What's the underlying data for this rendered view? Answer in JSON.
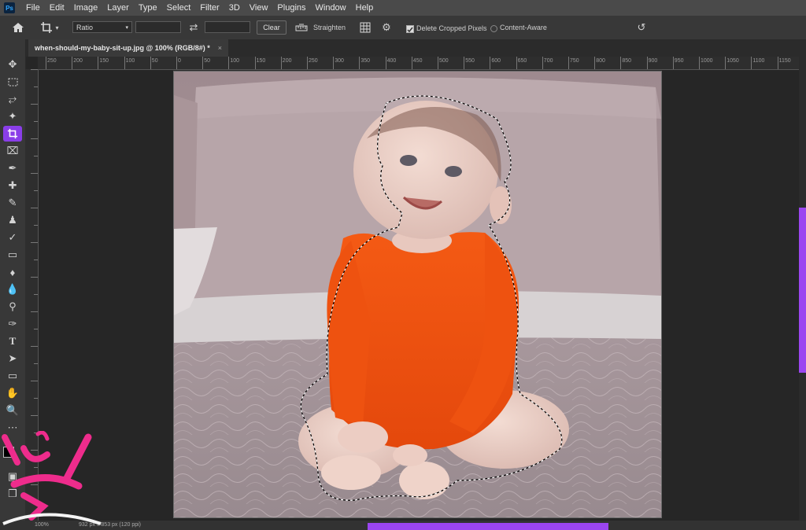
{
  "app": {
    "logo_text": "Ps"
  },
  "menu": [
    "File",
    "Edit",
    "Image",
    "Layer",
    "Type",
    "Select",
    "Filter",
    "3D",
    "View",
    "Plugins",
    "Window",
    "Help"
  ],
  "options": {
    "ratio_label": "Ratio",
    "clear_label": "Clear",
    "straighten_label": "Straighten",
    "delete_cropped_label": "Delete Cropped Pixels",
    "delete_cropped_checked": true,
    "content_aware_label": "Content-Aware",
    "content_aware_checked": false
  },
  "document": {
    "tab_title": "when-should-my-baby-sit-up.jpg @ 100% (RGB/8#) *",
    "close_glyph": "×"
  },
  "rulers": {
    "top_labels": [
      "250",
      "200",
      "150",
      "100",
      "50",
      "0",
      "50",
      "100",
      "150",
      "200",
      "250",
      "300",
      "350",
      "400",
      "450",
      "500",
      "550",
      "600",
      "650",
      "700",
      "750",
      "800",
      "850",
      "900",
      "950",
      "1000",
      "1050",
      "1100",
      "1150"
    ]
  },
  "status": {
    "zoom": "100%",
    "doc_size": "932 px x 853 px (120 ppi)"
  },
  "colors": {
    "accent": "#9b45f0",
    "onesie": "#f25410",
    "pillow": "#b7a5a9"
  },
  "icons": {
    "home": "home-icon",
    "crop": "crop-icon",
    "swap": "swap-icon",
    "grid": "grid-icon",
    "gear": "gear-icon",
    "reset": "reset-icon"
  }
}
